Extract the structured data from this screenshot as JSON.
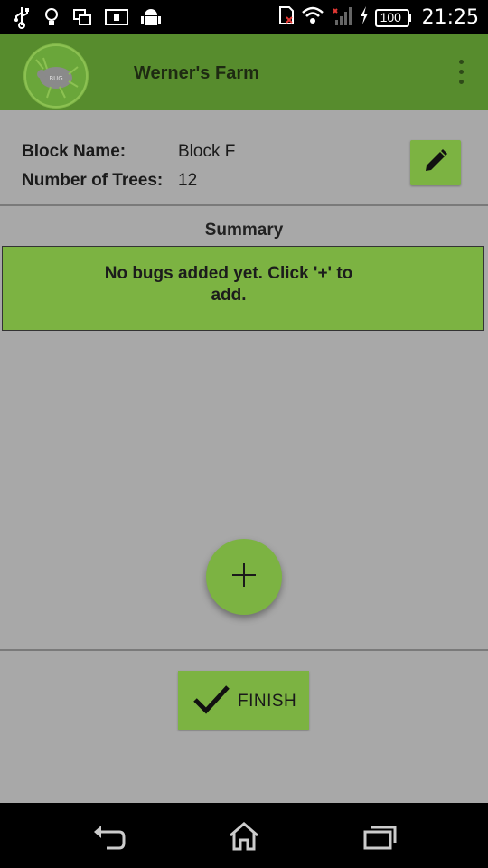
{
  "status_bar": {
    "battery_level": "100",
    "time": "21:25",
    "left_icons": [
      "usb-icon",
      "lightbulb-icon",
      "screen-mirror-icon",
      "news-icon",
      "android-icon"
    ],
    "right_icons": [
      "sim-missing-icon",
      "wifi-icon",
      "signal-icon",
      "charging-icon",
      "battery-icon"
    ]
  },
  "app_bar": {
    "title": "Werner's Farm",
    "logo_icon": "bug-logo-icon",
    "menu_icon": "overflow-menu-icon"
  },
  "block_info": {
    "name_label": "Block Name:",
    "name_value": "Block F",
    "trees_label": "Number of Trees:",
    "trees_value": "12",
    "edit_icon": "pencil-icon"
  },
  "summary": {
    "title": "Summary",
    "empty_message": "No bugs added yet. Click '+' to add."
  },
  "fab": {
    "icon": "plus-icon"
  },
  "finish_button": {
    "label": "FINISH",
    "icon": "check-icon"
  },
  "nav_bar": {
    "icons": [
      "back-icon",
      "home-icon",
      "recents-icon"
    ]
  },
  "colors": {
    "app_bar": "#578c2d",
    "accent_green": "#7cb342",
    "background": "#a8a8a8"
  }
}
